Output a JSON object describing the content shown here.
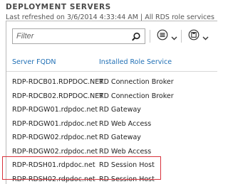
{
  "header": {
    "title": "DEPLOYMENT SERVERS",
    "subtitle": "Last refreshed on 3/6/2014 4:33:44 AM | All RDS role services | 8 tot"
  },
  "toolbar": {
    "filter_placeholder": "Filter",
    "search_icon": "search-icon",
    "list_options_icon": "list-options-icon",
    "save_icon": "save-icon",
    "dropdown_icon": "chevron-down-icon"
  },
  "table": {
    "columns": [
      "Server FQDN",
      "Installed Role Service"
    ],
    "rows": [
      {
        "fqdn": "RDP-RDCB01.RDPDOC.NET",
        "role": "RD Connection Broker"
      },
      {
        "fqdn": "RDP-RDCB02.RDPDOC.NET",
        "role": "RD Connection Broker"
      },
      {
        "fqdn": "RDP-RDGW01.rdpdoc.net",
        "role": "RD Gateway"
      },
      {
        "fqdn": "RDP-RDGW01.rdpdoc.net",
        "role": "RD Web Access"
      },
      {
        "fqdn": "RDP-RDGW02.rdpdoc.net",
        "role": "RD Gateway"
      },
      {
        "fqdn": "RDP-RDGW02.rdpdoc.net",
        "role": "RD Web Access"
      },
      {
        "fqdn": "RDP-RDSH01.rdpdoc.net",
        "role": "RD Session Host"
      },
      {
        "fqdn": "RDP-RDSH02.rdpdoc.net",
        "role": "RD Session Host"
      }
    ]
  },
  "colors": {
    "header_text": "#1f6fb5",
    "highlight_border": "#d8323c"
  }
}
